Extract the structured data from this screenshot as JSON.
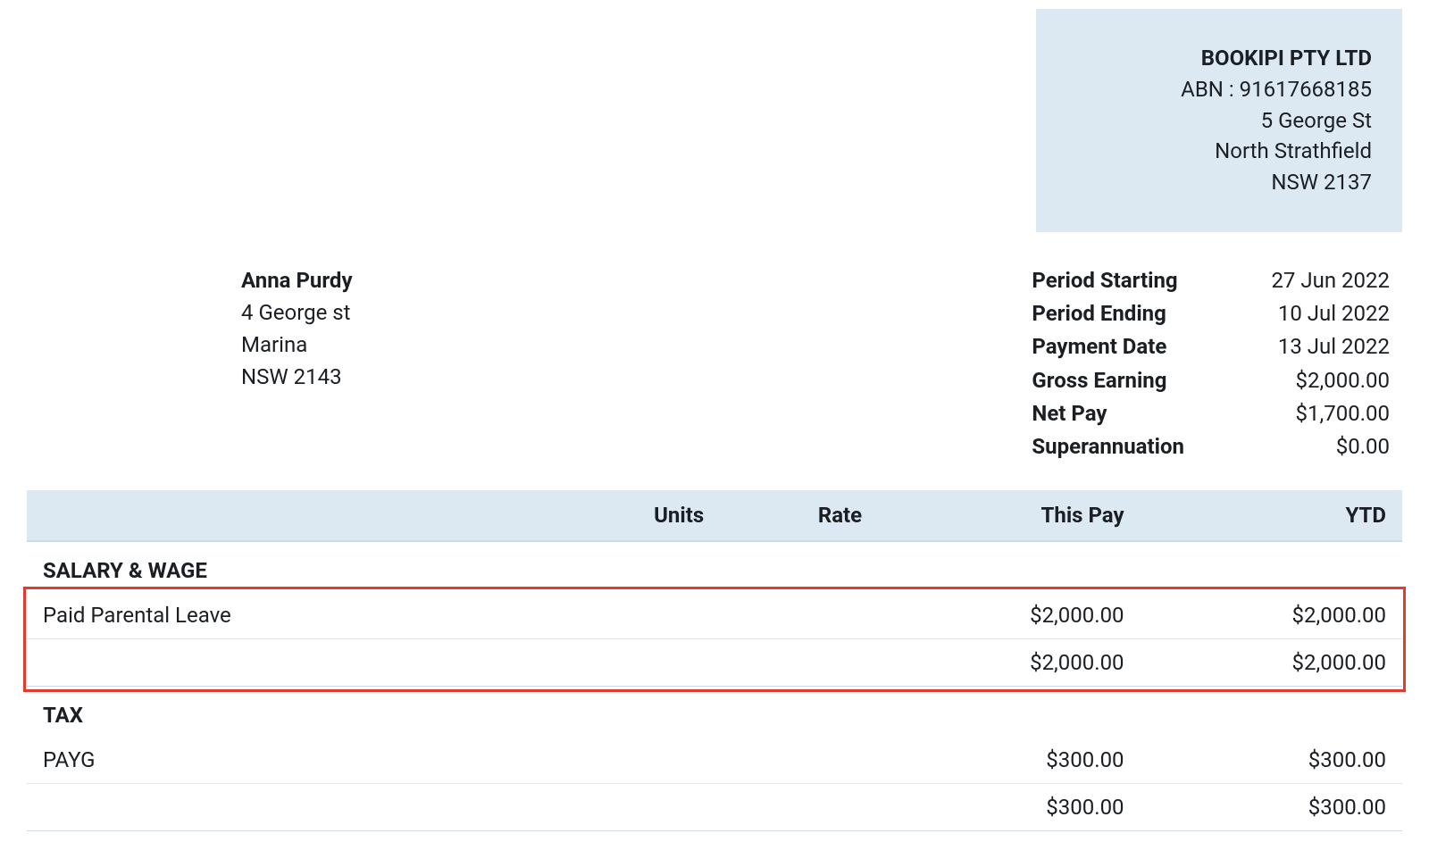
{
  "company": {
    "name": "BOOKIPI PTY LTD",
    "abn_line": "ABN : 91617668185",
    "address1": "5 George St",
    "address2": "North Strathfield",
    "address3": "NSW 2137"
  },
  "employee": {
    "name": "Anna Purdy",
    "address1": "4 George st",
    "address2": "Marina",
    "address3": "NSW 2143"
  },
  "summary": {
    "rows": [
      {
        "label": "Period Starting",
        "value": "27 Jun 2022"
      },
      {
        "label": "Period Ending",
        "value": "10 Jul 2022"
      },
      {
        "label": "Payment Date",
        "value": "13 Jul 2022"
      },
      {
        "label": "Gross Earning",
        "value": "$2,000.00"
      },
      {
        "label": "Net Pay",
        "value": "$1,700.00"
      },
      {
        "label": "Superannuation",
        "value": "$0.00"
      }
    ]
  },
  "table": {
    "headers": {
      "item": "",
      "units": "Units",
      "rate": "Rate",
      "this_pay": "This Pay",
      "ytd": "YTD"
    },
    "sections": [
      {
        "title": "SALARY & WAGE",
        "rows": [
          {
            "item": "Paid Parental Leave",
            "units": "",
            "rate": "",
            "this_pay": "$2,000.00",
            "ytd": "$2,000.00"
          }
        ],
        "subtotal": {
          "this_pay": "$2,000.00",
          "ytd": "$2,000.00"
        },
        "highlight": true
      },
      {
        "title": "TAX",
        "rows": [
          {
            "item": "PAYG",
            "units": "",
            "rate": "",
            "this_pay": "$300.00",
            "ytd": "$300.00"
          }
        ],
        "subtotal": {
          "this_pay": "$300.00",
          "ytd": "$300.00"
        },
        "highlight": false
      }
    ]
  }
}
